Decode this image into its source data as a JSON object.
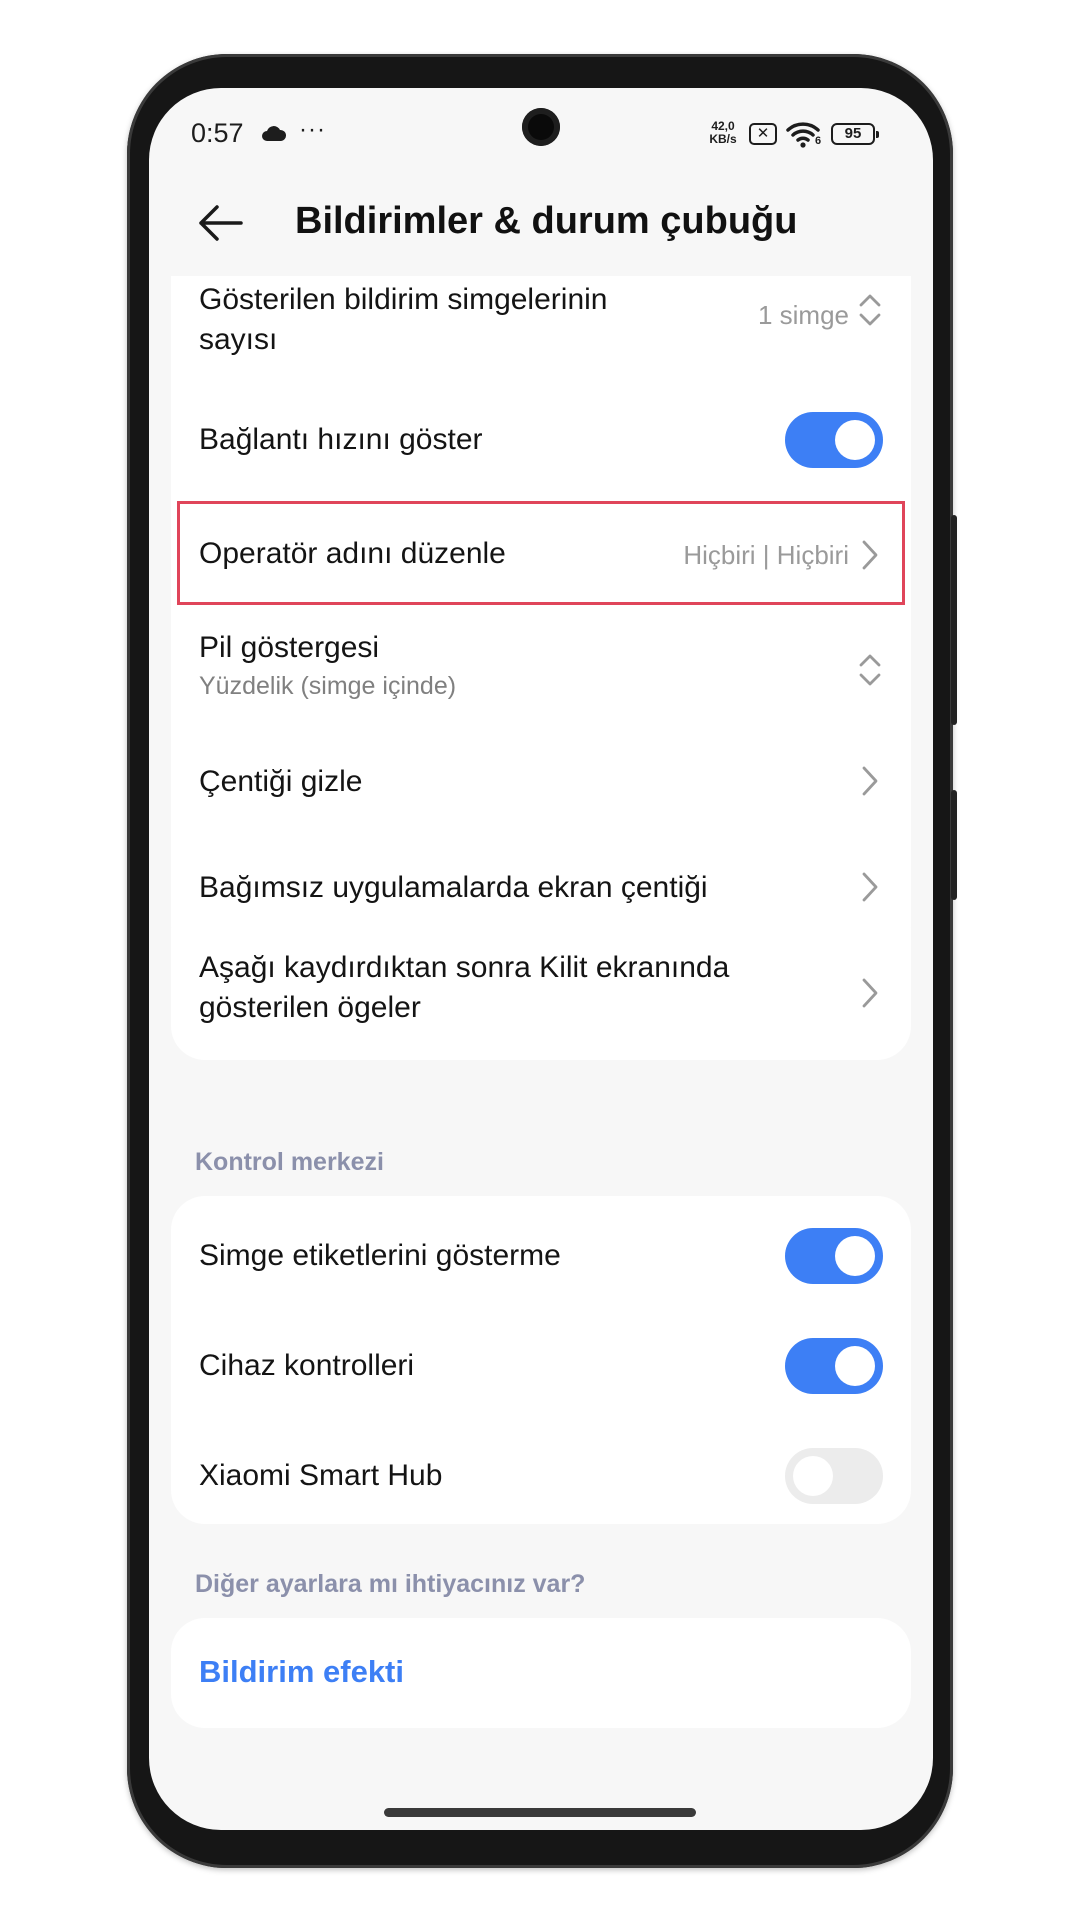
{
  "status_bar": {
    "time": "0:57",
    "cloud_icon": "cloud-icon",
    "more_dots": "···",
    "net_speed_value": "42,0",
    "net_speed_unit": "KB/s",
    "sim_icon_glyph": "✕",
    "wifi_badge": "6",
    "battery": "95"
  },
  "header": {
    "back_icon": "arrow-left-icon",
    "title": "Bildirimler & durum çubuğu"
  },
  "card1": {
    "icon_count": {
      "title_line1": "Gösterilen bildirim simgelerinin",
      "title_line2": "sayısı",
      "value": "1 simge"
    },
    "connection_speed": {
      "title": "Bağlantı hızını göster",
      "enabled": true
    },
    "operator_name": {
      "title": "Operatör adını düzenle",
      "value": "Hiçbiri | Hiçbiri"
    },
    "battery_indicator": {
      "title": "Pil göstergesi",
      "subtitle": "Yüzdelik (simge içinde)"
    },
    "hide_notch": {
      "title": "Çentiği gizle"
    },
    "app_notch": {
      "title": "Bağımsız uygulamalarda ekran çentiği"
    },
    "lockscreen_items": {
      "title_line1": "Aşağı kaydırdıktan sonra Kilit ekranında",
      "title_line2": "gösterilen ögeler"
    }
  },
  "control_center": {
    "section_label": "Kontrol merkezi",
    "icon_labels": {
      "title": "Simge etiketlerini gösterme",
      "enabled": true
    },
    "device_controls": {
      "title": "Cihaz kontrolleri",
      "enabled": true
    },
    "smart_hub": {
      "title": "Xiaomi Smart Hub",
      "enabled": false
    }
  },
  "more_settings": {
    "section_label": "Diğer ayarlara mı ihtiyacınız var?",
    "notification_effect": "Bildirim efekti"
  },
  "colors": {
    "accent": "#3d7ff5",
    "highlight_border": "#e0455a",
    "section_label": "#8b90ab",
    "background": "#f7f7f7"
  }
}
